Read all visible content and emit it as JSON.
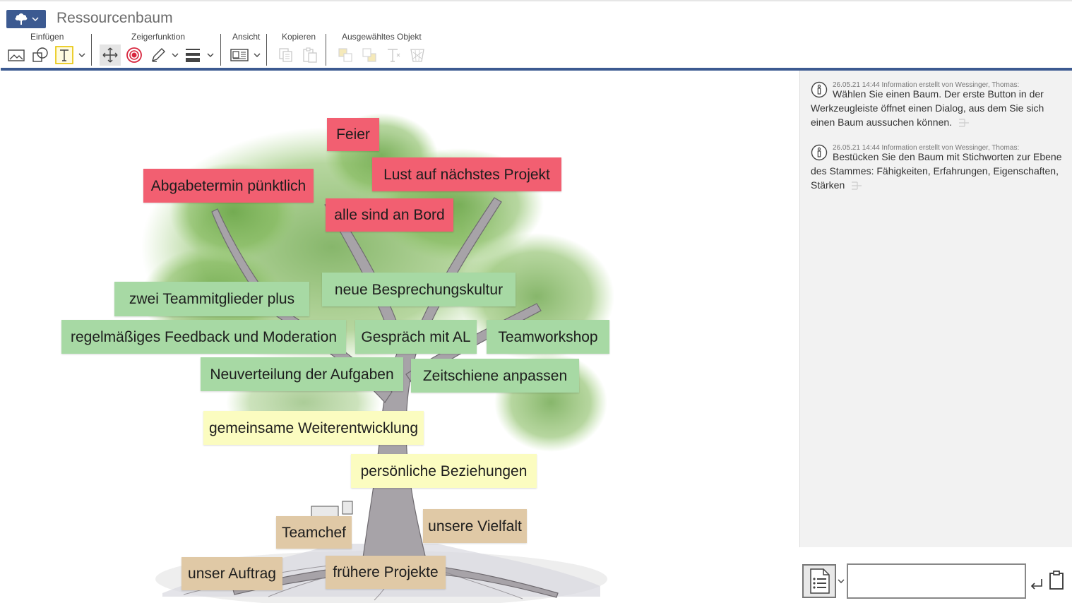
{
  "app": {
    "title": "Ressourcenbaum"
  },
  "toolbar": {
    "groups": {
      "einfuegen": "Einfügen",
      "zeigerfunktion": "Zeigerfunktion",
      "ansicht": "Ansicht",
      "kopieren": "Kopieren",
      "ausgewaehltes_objekt": "Ausgewähltes Objekt"
    },
    "accent": "#3c5a91"
  },
  "canvas": {
    "notes": [
      {
        "text": "Feier",
        "color": "red"
      },
      {
        "text": "Lust auf nächstes Projekt",
        "color": "red"
      },
      {
        "text": "Abgabetermin pünktlich",
        "color": "red"
      },
      {
        "text": "alle sind an Bord",
        "color": "red"
      },
      {
        "text": "neue Besprechungskultur",
        "color": "green"
      },
      {
        "text": "zwei Teammitglieder plus",
        "color": "green"
      },
      {
        "text": "regelmäßiges Feedback und Moderation",
        "color": "green"
      },
      {
        "text": "Gespräch mit AL",
        "color": "green"
      },
      {
        "text": "Teamworkshop",
        "color": "green"
      },
      {
        "text": "Neuverteilung der Aufgaben",
        "color": "green"
      },
      {
        "text": "Zeitschiene anpassen",
        "color": "green"
      },
      {
        "text": "gemeinsame Weiterentwicklung",
        "color": "yellow"
      },
      {
        "text": "persönliche Beziehungen",
        "color": "yellow"
      },
      {
        "text": "unsere Vielfalt",
        "color": "tan"
      },
      {
        "text": "Teamchef",
        "color": "tan"
      },
      {
        "text": "unser Auftrag",
        "color": "tan"
      },
      {
        "text": "frühere Projekte",
        "color": "tan"
      }
    ],
    "colors": {
      "red": "#f25f71",
      "green": "#a7d9a4",
      "yellow": "#fbfcc0",
      "tan": "#e0c9a6"
    }
  },
  "side": {
    "messages": [
      {
        "meta": "26.05.21 14:44 Information erstellt von Wessinger, Thomas:",
        "text": "Wählen Sie einen Baum. Der erste Button in der Werkzeugleiste öffnet einen Dialog, aus dem Sie sich einen Baum aussuchen können."
      },
      {
        "meta": "26.05.21 14:44 Information erstellt von Wessinger, Thomas:",
        "text": "Bestücken Sie den Baum mit Stichworten zur Ebene des Stammes: Fähigkeiten, Erfahrungen, Eigenschaften, Stärken"
      }
    ]
  },
  "bottom": {
    "comment_value": "",
    "comment_placeholder": ""
  }
}
